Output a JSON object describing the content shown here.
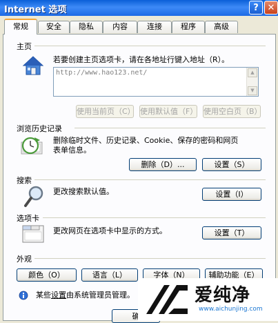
{
  "window": {
    "title": "Internet 选项",
    "help_button": "?",
    "close_button": "✕"
  },
  "tabs": [
    {
      "label": "常规"
    },
    {
      "label": "安全"
    },
    {
      "label": "隐私"
    },
    {
      "label": "内容"
    },
    {
      "label": "连接"
    },
    {
      "label": "程序"
    },
    {
      "label": "高级"
    }
  ],
  "home": {
    "heading": "主页",
    "description": "若要创建主页选项卡，请在各地址行键入地址（R）。",
    "url_value": "http://www.hao123.net/",
    "buttons": {
      "use_current": "使用当前页（C）",
      "use_default": "使用默认值（F）",
      "use_blank": "使用空白页（B）"
    }
  },
  "history": {
    "heading": "浏览历史记录",
    "description_line1": "删除临时文件、历史记录、Cookie、保存的密码和网页",
    "description_line2": "表单信息。",
    "delete_button": "删除（D）...",
    "settings_button": "设置（S）"
  },
  "search": {
    "heading": "搜索",
    "description": "更改搜索默认值。",
    "settings_button": "设置（I）"
  },
  "tabbed": {
    "heading": "选项卡",
    "description": "更改网页在选项卡中显示的方式。",
    "settings_button": "设置（T）"
  },
  "appearance": {
    "heading": "外观",
    "colors_button": "颜色（O）",
    "languages_button": "语言（L）",
    "fonts_button": "字体（N）",
    "accessibility_button": "辅助功能（E）"
  },
  "footer": {
    "note_prefix": "某些",
    "note_link": "设置",
    "note_suffix": "由系统管理员管理。",
    "ok_button": "确"
  },
  "watermark": {
    "brand": "爱纯净",
    "url": "www.aichunjing.com"
  }
}
